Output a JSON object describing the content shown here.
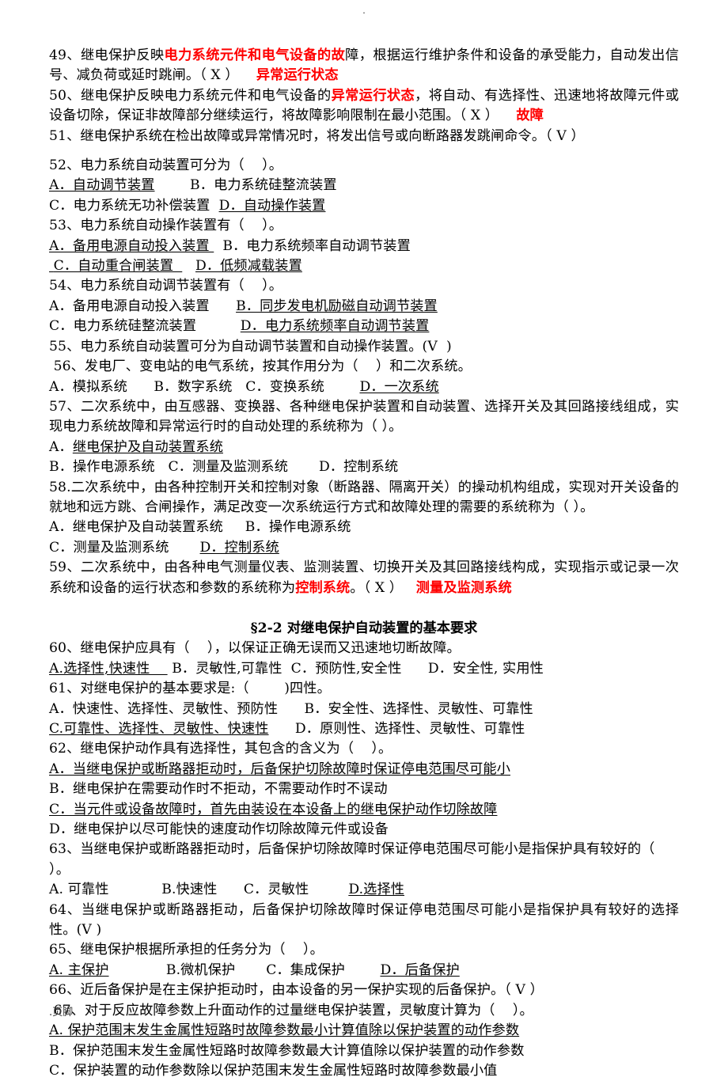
{
  "page": {
    "top_mark": ".",
    "footer": ".页脚."
  },
  "section_heading": "§2-2   对继电保护自动装置的基本要求",
  "items": {
    "q49": {
      "pre": "49、继电保护反映",
      "red1": "电力系统元件和电气设备的故",
      "post": "障，根据运行维护条件和设备的承受能力，自动发出信号、减负荷或延时跳闸。（ X ）",
      "answer_red": "异常运行状态"
    },
    "q50": {
      "pre": "50、继电保护反映电力系统元件和电气设备的",
      "red1": "异常运行状态",
      "post": "，将自动、有选择性、迅速地将故障元件或设备切除，保证非故障部分继续运行，将故障影响限制在最小范围。（ X ）",
      "answer_red": "故障"
    },
    "q51": {
      "text": "51、继电保护系统在检出故障或异常情况时，将发出信号或向断路器发跳闸命令。（ V ）"
    },
    "q52": {
      "stem": "52、电力系统自动装置可分为（    ）。",
      "optA": "A．自动调节装置",
      "optB": "B．电力系统硅整流装置",
      "optC": "C．电力系统无功补偿装置",
      "optD": "D．自动操作装置"
    },
    "q53": {
      "stem": "53、电力系统自动操作装置有（    ）。",
      "optA": "A．备用电源自动投入装置 ",
      "optB": "B．电力系统频率自动调节装置",
      "optC": " C．自动重合闸装置  ",
      "optD": "D．低频减载装置"
    },
    "q54": {
      "stem": "54、电力系统自动调节装置有（    ）。",
      "optA": "A．备用电源自动投入装置",
      "optB": "B．同步发电机励磁自动调节装置",
      "optC": "C．电力系统硅整流装置",
      "optD": "D．电力系统频率自动调节装置"
    },
    "q55": {
      "text": "55、电力系统自动装置可分为自动调节装置和自动操作装置。(V  )"
    },
    "q56": {
      "stem": " 56、发电厂、变电站的电气系统，按其作用分为（    ）和二次系统。",
      "optA": "A．模拟系统",
      "optB": "B．数字系统",
      "optC": "C．变换系统",
      "optD": "D．一次系统"
    },
    "q57": {
      "stem": "57、二次系统中，由互感器、变换器、各种继电保护装置和自动装置、选择开关及其回路接线组成，实现电力系统故障和异常运行时的自动处理的系统称为（    ）。",
      "optA_prefix": "A．",
      "optA": "继电保护及自动装置系统",
      "optB": "B．操作电源系统",
      "optC": "C．测量及监测系统",
      "optD": "D．控制系统"
    },
    "q58": {
      "stem": "58.二次系统中，由各种控制开关和控制对象（断路器、隔离开关）的操动机构组成，实现对开关设备的就地和远方跳、合闸操作，满足改变一次系统运行方式和故障处理的需要的系统称为（    ）。",
      "optA": "A．继电保护及自动装置系统",
      "optB": "B．操作电源系统",
      "optC": "C．测量及监测系统",
      "optD": "D．控制系统"
    },
    "q59": {
      "pre": "59、二次系统中，由各种电气测量仪表、监测装置、切换开关及其回路接线构成，实现指示或记录一次系统和设备的运行状态和参数的系统称为",
      "red1": "控制系统",
      "post": "。（ X ）",
      "answer_red": "测量及监测系统"
    },
    "q60": {
      "stem": "60、继电保护应具有（    ），以保证正确无误而又迅速地切断故障。",
      "optA": "A.选择性,快速性    ",
      "optB": "B．灵敏性,可靠性",
      "optC": "C．预防性,安全性",
      "optD": "D．安全性, 实用性"
    },
    "q61": {
      "stem": "61、对继电保护的基本要求是:（        )四性。",
      "optA": "A．快速性、选择性、灵敏性、预防性",
      "optB": "B．安全性、选择性、灵敏性、可靠性",
      "optC": "C.可靠性、选择性、灵敏性、快速性",
      "optD": "D．原则性、选择性、灵敏性、可靠性"
    },
    "q62": {
      "stem": "62、继电保护动作具有选择性，其包含的含义为（    ）。",
      "optA": "A．当继电保护或断路器拒动时，后备保护切除故障时保证停电范围尽可能小",
      "optB": "B．继电保护在需要动作时不拒动，不需要动作时不误动",
      "optC": "C．当元件或设备故障时，首先由装设在本设备上的继电保护动作切除故障",
      "optD": "D．继电保护以尽可能快的速度动作切除故障元件或设备"
    },
    "q63": {
      "stem": "63、当继电保护或断路器拒动时，后备保护切除故障时保证停电范围尽可能小是指保护具有较好的（    ）。",
      "optA": "A. 可靠性",
      "optB": "B.快速性",
      "optC": "C．灵敏性",
      "optD": "D.选择性"
    },
    "q64": {
      "text": "64、当继电保护或断路器拒动，后备保护切除故障时保证停电范围尽可能小是指保护具有较好的选择性。(V  )"
    },
    "q65": {
      "stem": "65、继电保护根据所承担的任务分为（    ）。",
      "optA": "A. 主保护",
      "optB": "B.微机保护",
      "optC": "C．集成保护",
      "optD": "D．后备保护"
    },
    "q66": {
      "text": "66、近后备保护是在主保护拒动时，由本设备的另一保护实现的后备保护。（ V ）"
    },
    "q67": {
      "stem": " 67、对于反应故障参数上升面动作的过量继电保护装置，灵敏度计算为（    ）。",
      "optA": "A. 保护范围末发生金属性短路时故障参数最小计算值除以保护装置的动作参数",
      "optB": "B．保护范围末发生金属性短路时故障参数最大计算值除以保护装置的动作参数",
      "optC": "C．保护装置的动作参数除以保护范围末发生金属性短路时故障参数最小值"
    }
  },
  "colors": {
    "red": "#ff0000",
    "text": "#000000",
    "background": "#ffffff"
  }
}
